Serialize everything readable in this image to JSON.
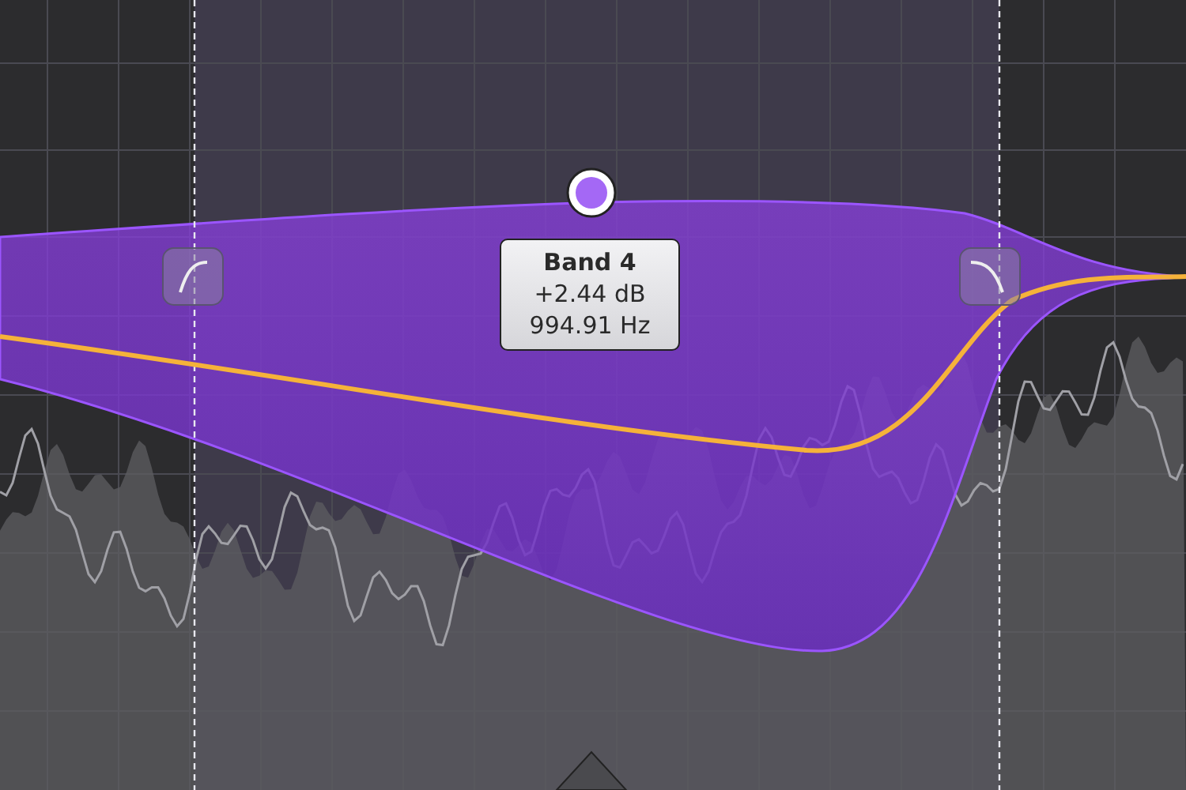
{
  "band": {
    "selected": true
  },
  "tooltip": {
    "title": "Band 4",
    "gain": "+2.44 dB",
    "frequency": "994.91 Hz"
  }
}
